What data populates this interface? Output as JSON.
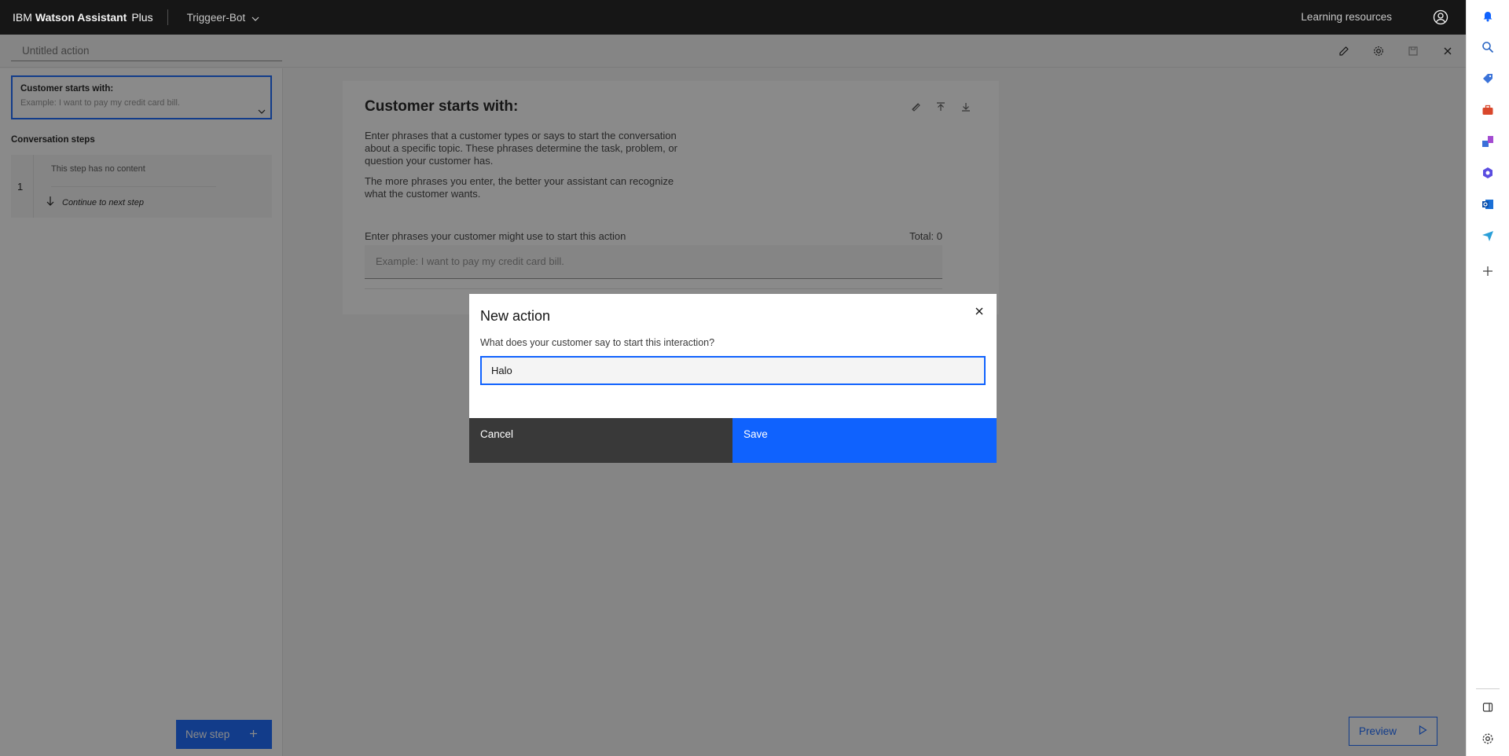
{
  "header": {
    "brand_ibm": "IBM",
    "brand_product": "Watson Assistant",
    "brand_plan": "Plus",
    "assistant_name": "Triggeer-Bot",
    "learning_resources": "Learning resources"
  },
  "action": {
    "title_placeholder": "Untitled action"
  },
  "left_panel": {
    "start_title": "Customer starts with:",
    "start_placeholder": "Example: I want to pay my credit card bill.",
    "conversation_steps": "Conversation steps",
    "step_number": "1",
    "step_empty": "This step has no content",
    "step_continue": "Continue to next step",
    "new_step": "New step"
  },
  "card": {
    "title": "Customer starts with:",
    "desc1": "Enter phrases that a customer types or says to start the conversation about a specific topic. These phrases determine the task, problem, or question your customer has.",
    "desc2": "The more phrases you enter, the better your assistant can recognize what the customer wants.",
    "phrases_label": "Enter phrases your customer might use to start this action",
    "total": "Total: 0",
    "phrase_placeholder": "Example: I want to pay my credit card bill."
  },
  "preview": "Preview",
  "modal": {
    "title": "New action",
    "question": "What does your customer say to start this interaction?",
    "input_value": "Halo",
    "cancel": "Cancel",
    "save": "Save"
  },
  "colors": {
    "accent": "#0f62fe",
    "header_bg": "#161616",
    "cancel_bg": "#393939"
  }
}
